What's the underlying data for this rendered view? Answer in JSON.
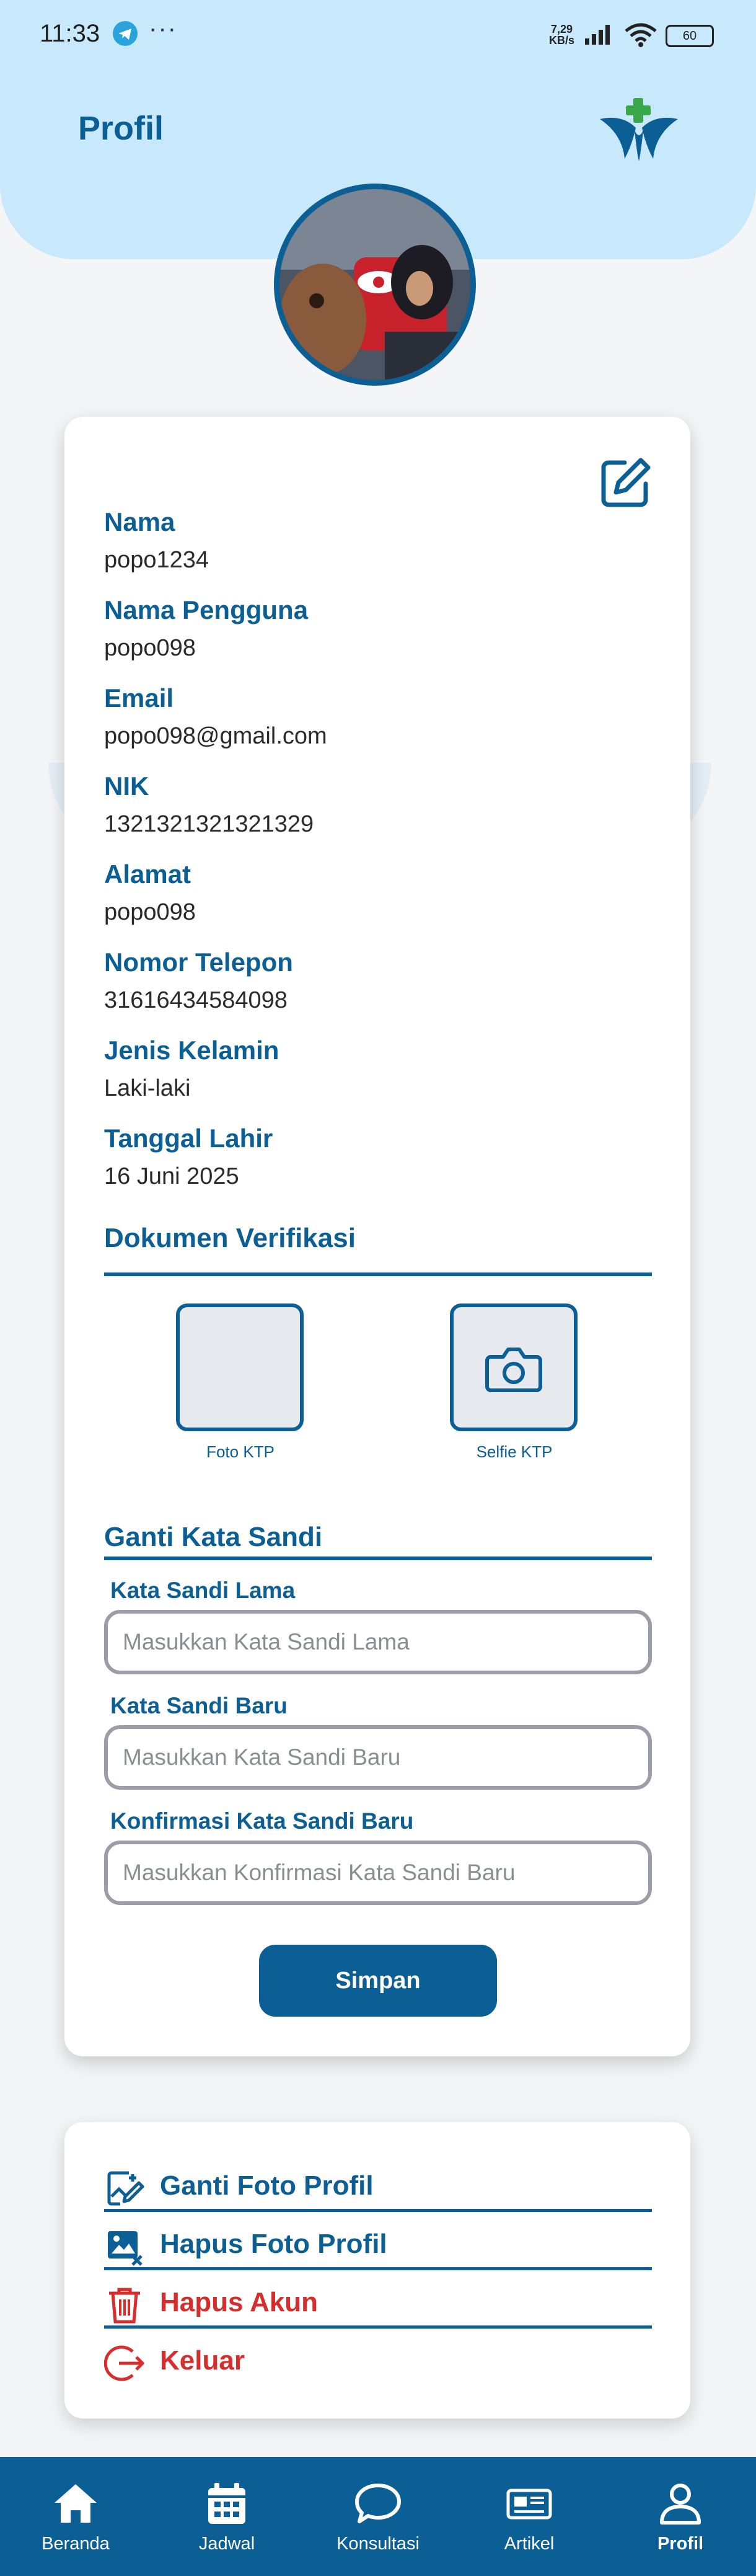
{
  "status_bar": {
    "time": "11:33",
    "dots": "···",
    "net_speed": "7,29",
    "net_unit": "KB/s",
    "battery": "60"
  },
  "header": {
    "title": "Profil"
  },
  "profile": {
    "edit_icon": "edit-icon",
    "fields": [
      {
        "label": "Nama",
        "value": "popo1234"
      },
      {
        "label": "Nama Pengguna",
        "value": "popo098"
      },
      {
        "label": "Email",
        "value": "popo098@gmail.com"
      },
      {
        "label": "NIK",
        "value": "1321321321321329"
      },
      {
        "label": "Alamat",
        "value": "popo098"
      },
      {
        "label": "Nomor Telepon",
        "value": "31616434584098"
      },
      {
        "label": "Jenis Kelamin",
        "value": "Laki-laki"
      },
      {
        "label": "Tanggal Lahir",
        "value": "16 Juni 2025"
      }
    ]
  },
  "documents": {
    "title": "Dokumen Verifikasi",
    "items": [
      {
        "caption": "Foto KTP"
      },
      {
        "caption": "Selfie KTP",
        "icon": "camera-icon"
      }
    ]
  },
  "password": {
    "title": "Ganti Kata Sandi",
    "fields": [
      {
        "label": "Kata Sandi Lama",
        "placeholder": "Masukkan Kata Sandi Lama"
      },
      {
        "label": "Kata Sandi Baru",
        "placeholder": "Masukkan Kata Sandi Baru"
      },
      {
        "label": "Konfirmasi Kata Sandi Baru",
        "placeholder": "Masukkan Konfirmasi Kata Sandi Baru"
      }
    ],
    "save_label": "Simpan"
  },
  "menu": {
    "items": [
      {
        "label": "Ganti Foto Profil",
        "icon": "change-photo-icon",
        "color": "#0c5f95"
      },
      {
        "label": "Hapus Foto Profil",
        "icon": "remove-photo-icon",
        "color": "#0c5f95"
      },
      {
        "label": "Hapus Akun",
        "icon": "trash-icon",
        "color": "#d62d2d"
      },
      {
        "label": "Keluar",
        "icon": "logout-icon",
        "color": "#d62d2d"
      }
    ]
  },
  "bottom_nav": {
    "items": [
      {
        "label": "Beranda",
        "icon": "home-icon"
      },
      {
        "label": "Jadwal",
        "icon": "calendar-icon"
      },
      {
        "label": "Konsultasi",
        "icon": "chat-icon"
      },
      {
        "label": "Artikel",
        "icon": "article-icon"
      },
      {
        "label": "Profil",
        "icon": "user-icon",
        "active": true
      }
    ]
  },
  "colors": {
    "primary": "#0c5f95",
    "header_bg": "#c8e8fb",
    "danger": "#d62d2d",
    "logo_green": "#3aa84a"
  }
}
